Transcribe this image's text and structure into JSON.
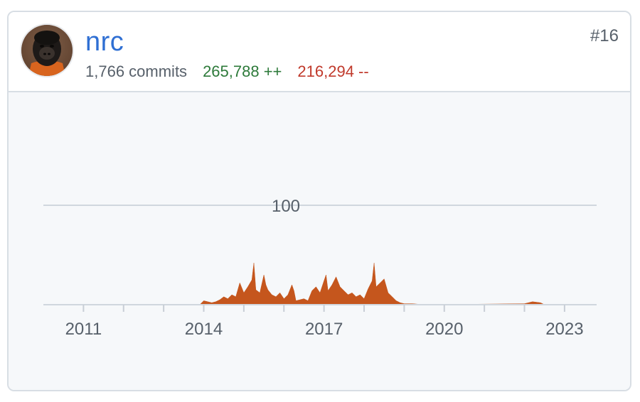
{
  "contributor": {
    "username": "nrc",
    "commits_text": "1,766 commits",
    "additions_text": "265,788 ++",
    "deletions_text": "216,294 --",
    "rank": "#16",
    "avatar_icon": "gorilla-mask-avatar"
  },
  "colors": {
    "link": "#2f6fd3",
    "additions": "#2d7a3a",
    "deletions": "#c0392b",
    "area_fill": "#c5561d",
    "chart_bg": "#f6f8fa"
  },
  "chart_data": {
    "type": "area",
    "title": "",
    "xlabel": "",
    "ylabel": "",
    "x_tick_labels": [
      "2011",
      "2014",
      "2017",
      "2020",
      "2023"
    ],
    "xlim": [
      2010.0,
      2023.8
    ],
    "ylim": [
      0,
      200
    ],
    "reference_line": {
      "value": 100,
      "label": "100"
    },
    "grid": false,
    "series": [
      {
        "name": "",
        "x": [
          2013.9,
          2014.0,
          2014.1,
          2014.2,
          2014.3,
          2014.4,
          2014.5,
          2014.6,
          2014.7,
          2014.8,
          2014.9,
          2015.0,
          2015.1,
          2015.2,
          2015.25,
          2015.3,
          2015.4,
          2015.5,
          2015.55,
          2015.6,
          2015.7,
          2015.8,
          2015.9,
          2016.0,
          2016.1,
          2016.2,
          2016.25,
          2016.3,
          2016.4,
          2016.5,
          2016.6,
          2016.7,
          2016.8,
          2016.9,
          2017.0,
          2017.05,
          2017.1,
          2017.2,
          2017.3,
          2017.4,
          2017.5,
          2017.6,
          2017.7,
          2017.8,
          2017.9,
          2018.0,
          2018.1,
          2018.2,
          2018.25,
          2018.3,
          2018.4,
          2018.5,
          2018.6,
          2018.7,
          2018.8,
          2018.9,
          2019.0,
          2019.2,
          2019.5,
          2022.0,
          2022.2,
          2022.4,
          2022.5
        ],
        "values": [
          0,
          4,
          3,
          2,
          3,
          5,
          8,
          6,
          10,
          8,
          22,
          12,
          18,
          25,
          42,
          15,
          12,
          30,
          20,
          15,
          10,
          8,
          12,
          6,
          10,
          20,
          14,
          4,
          5,
          6,
          4,
          14,
          18,
          12,
          24,
          30,
          14,
          20,
          28,
          18,
          14,
          10,
          12,
          8,
          10,
          6,
          16,
          24,
          42,
          18,
          22,
          26,
          12,
          8,
          4,
          2,
          1,
          1,
          0,
          1,
          3,
          2,
          0
        ]
      }
    ]
  }
}
